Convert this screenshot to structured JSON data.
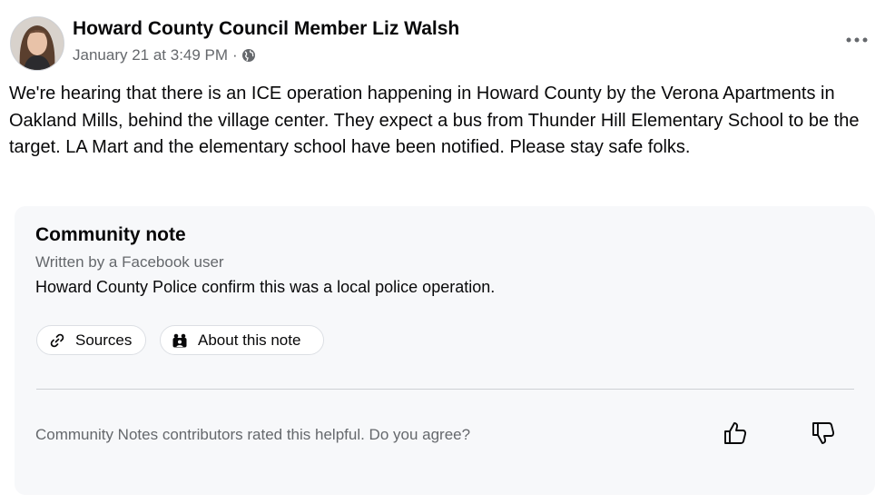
{
  "post": {
    "author": "Howard County Council Member Liz Walsh",
    "timestamp": "January 21 at 3:49 PM",
    "separator": "·",
    "audience_icon": "globe-icon",
    "more_icon": "more-options-icon",
    "text": "We're hearing that there is an ICE operation happening in Howard County by the Verona Apartments in Oakland Mills, behind the village center. They expect a bus from Thunder Hill Elementary School to be the target. LA Mart and the elementary school have been notified. Please stay safe folks."
  },
  "community_note": {
    "title": "Community note",
    "written_by": "Written by a Facebook user",
    "body": "Howard County Police confirm this was a local police operation.",
    "sources_label": "Sources",
    "sources_icon": "link-icon",
    "about_label": "About this note",
    "about_icon": "people-icon",
    "rating_prompt": "Community Notes contributors rated this helpful. Do you agree?",
    "thumbs_up_icon": "thumbs-up-icon",
    "thumbs_down_icon": "thumbs-down-icon"
  },
  "colors": {
    "text_primary": "#080809",
    "text_secondary": "#65686c",
    "card_background": "#f7f8fa",
    "divider": "#ced0d4"
  }
}
